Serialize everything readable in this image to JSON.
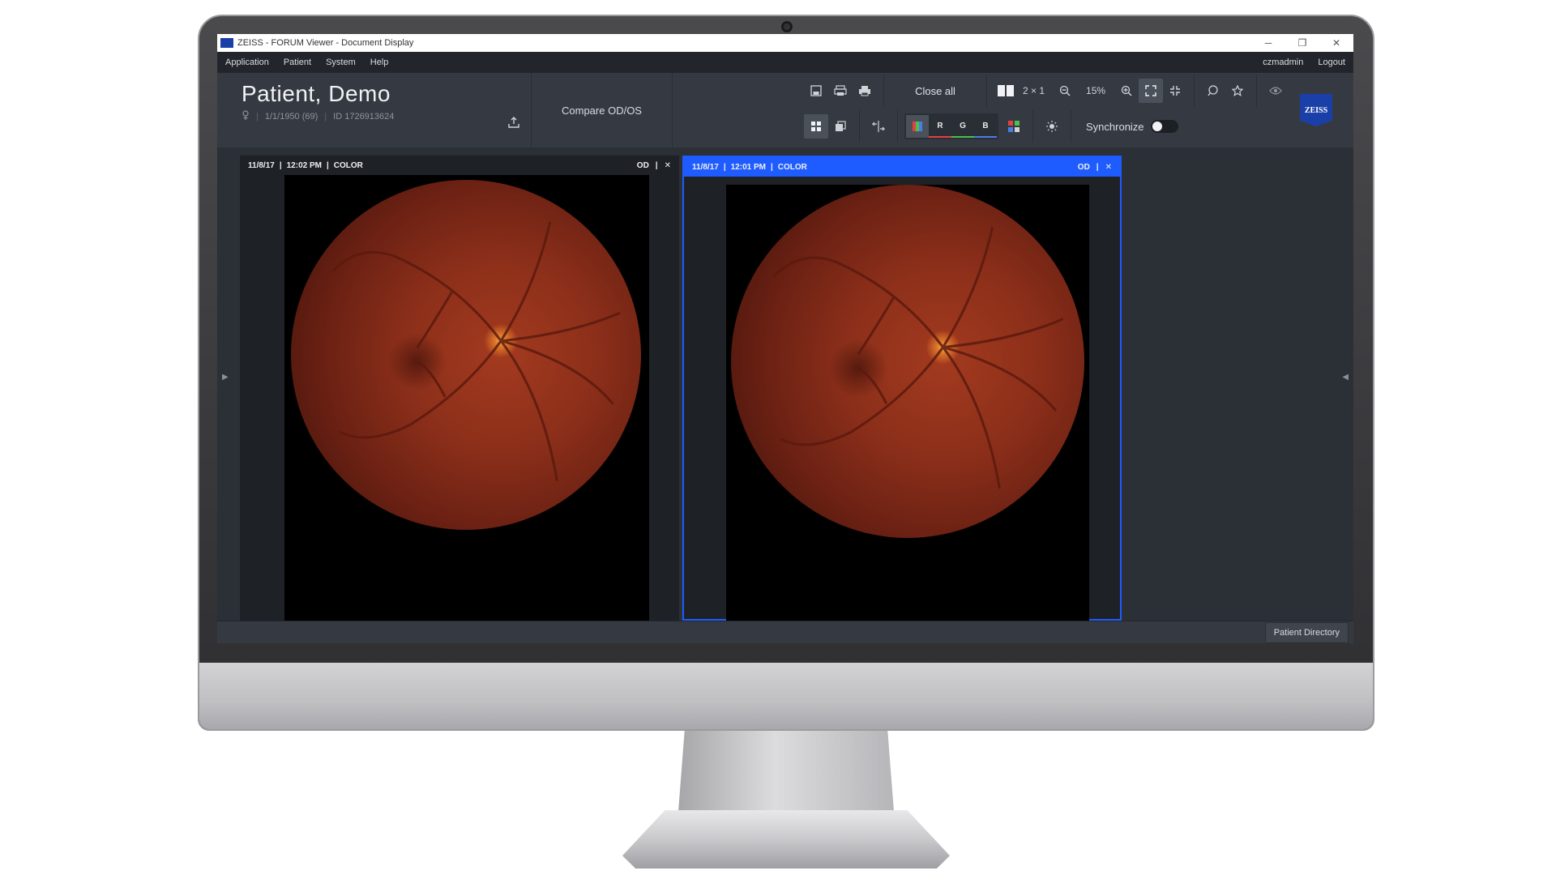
{
  "window": {
    "title": "ZEISS - FORUM Viewer - Document Display",
    "minimize": "─",
    "maximize": "❐",
    "close": "✕"
  },
  "menu": {
    "items": [
      "Application",
      "Patient",
      "System",
      "Help"
    ],
    "user": "czmadmin",
    "logout": "Logout"
  },
  "patient": {
    "name": "Patient, Demo",
    "dob": "1/1/1950 (69)",
    "id": "ID 1726913624"
  },
  "toolbar": {
    "compare_label": "Compare OD/OS",
    "close_all": "Close all",
    "layout": "2 × 1",
    "zoom": "15%",
    "synchronize": "Synchronize",
    "channels": {
      "r": "R",
      "g": "G",
      "b": "B"
    }
  },
  "panes": [
    {
      "date": "11/8/17",
      "time": "12:02 PM",
      "type": "COLOR",
      "eye": "OD",
      "sep": "|",
      "close": "✕"
    },
    {
      "date": "11/8/17",
      "time": "12:01 PM",
      "type": "COLOR",
      "eye": "OD",
      "sep": "|",
      "close": "✕"
    }
  ],
  "status": {
    "patient_directory": "Patient Directory"
  },
  "brand": {
    "logo": "ZEISS",
    "accent": "#1f5cff",
    "logo_color": "#1a3fa8"
  }
}
